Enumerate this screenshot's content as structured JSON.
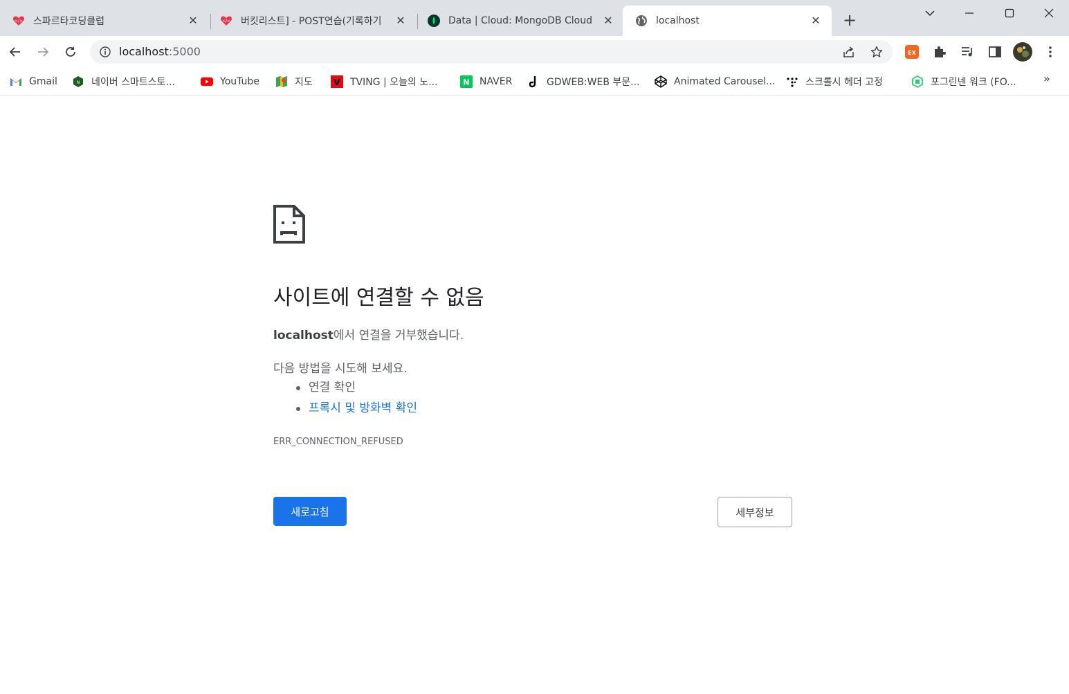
{
  "tabs": [
    {
      "title": "스파르타코딩클럽",
      "favicon": "sparta-icon"
    },
    {
      "title": "버킷리스트] - POST연습(기록하기",
      "favicon": "sparta-icon"
    },
    {
      "title": "Data | Cloud: MongoDB Cloud",
      "favicon": "mongodb-icon"
    },
    {
      "title": "localhost",
      "favicon": "globe-icon",
      "active": true
    }
  ],
  "tab_close_glyph": "✕",
  "new_tab_glyph": "+",
  "address": {
    "host": "localhost",
    "port": ":5000"
  },
  "bookmarks": [
    {
      "label": "Gmail",
      "icon": "gmail-icon"
    },
    {
      "label": "네이버 스마트스토...",
      "icon": "naver-smartstore-icon"
    },
    {
      "label": "YouTube",
      "icon": "youtube-icon"
    },
    {
      "label": "지도",
      "icon": "maps-icon"
    },
    {
      "label": "TVING | 오늘의 노...",
      "icon": "tving-icon"
    },
    {
      "label": "NAVER",
      "icon": "naver-icon"
    },
    {
      "label": "GDWEB:WEB 부문...",
      "icon": "gdweb-icon"
    },
    {
      "label": "Animated Carousel...",
      "icon": "codepen-icon"
    },
    {
      "label": "스크롤시 헤더 고정",
      "icon": "dots-icon"
    },
    {
      "label": "포그린넨 워크 (FO...",
      "icon": "fogreen-icon"
    }
  ],
  "bookmarks_more": "»",
  "error": {
    "title": "사이트에 연결할 수 없음",
    "host": "localhost",
    "message_suffix": "에서 연결을 거부했습니다.",
    "try_label": "다음 방법을 시도해 보세요.",
    "suggestions": [
      "연결 확인",
      "프록시 및 방화벽 확인"
    ],
    "code": "ERR_CONNECTION_REFUSED",
    "reload_label": "새로고침",
    "details_label": "세부정보"
  },
  "colors": {
    "accent": "#1a73e8",
    "tabstrip": "#dee1e6",
    "omnibox": "#f1f3f4"
  }
}
